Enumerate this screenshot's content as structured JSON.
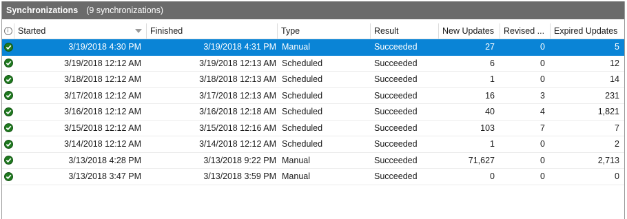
{
  "window": {
    "title": "Synchronizations",
    "count_label": "(9 synchronizations)"
  },
  "columns": {
    "info_icon": "info-icon",
    "started": "Started",
    "finished": "Finished",
    "type": "Type",
    "result": "Result",
    "new_updates": "New Updates",
    "revised": "Revised ...",
    "expired_updates": "Expired Updates"
  },
  "colors": {
    "selection": "#0a84d6",
    "success_icon": "#1f7a1f",
    "titlebar": "#6b6b6b"
  },
  "rows": [
    {
      "status_icon": "success-check-icon",
      "started": "3/19/2018 4:30 PM",
      "finished": "3/19/2018 4:31 PM",
      "type": "Manual",
      "result": "Succeeded",
      "new_updates": "27",
      "revised": "0",
      "expired": "5",
      "selected": true
    },
    {
      "status_icon": "success-check-icon",
      "started": "3/19/2018 12:12 AM",
      "finished": "3/19/2018 12:13 AM",
      "type": "Scheduled",
      "result": "Succeeded",
      "new_updates": "6",
      "revised": "0",
      "expired": "12",
      "selected": false
    },
    {
      "status_icon": "success-check-icon",
      "started": "3/18/2018 12:12 AM",
      "finished": "3/18/2018 12:13 AM",
      "type": "Scheduled",
      "result": "Succeeded",
      "new_updates": "1",
      "revised": "0",
      "expired": "14",
      "selected": false
    },
    {
      "status_icon": "success-check-icon",
      "started": "3/17/2018 12:12 AM",
      "finished": "3/17/2018 12:13 AM",
      "type": "Scheduled",
      "result": "Succeeded",
      "new_updates": "16",
      "revised": "3",
      "expired": "231",
      "selected": false
    },
    {
      "status_icon": "success-check-icon",
      "started": "3/16/2018 12:12 AM",
      "finished": "3/16/2018 12:18 AM",
      "type": "Scheduled",
      "result": "Succeeded",
      "new_updates": "40",
      "revised": "4",
      "expired": "1,821",
      "selected": false
    },
    {
      "status_icon": "success-check-icon",
      "started": "3/15/2018 12:12 AM",
      "finished": "3/15/2018 12:16 AM",
      "type": "Scheduled",
      "result": "Succeeded",
      "new_updates": "103",
      "revised": "7",
      "expired": "7",
      "selected": false
    },
    {
      "status_icon": "success-check-icon",
      "started": "3/14/2018 12:12 AM",
      "finished": "3/14/2018 12:12 AM",
      "type": "Scheduled",
      "result": "Succeeded",
      "new_updates": "1",
      "revised": "0",
      "expired": "2",
      "selected": false
    },
    {
      "status_icon": "success-check-icon",
      "started": "3/13/2018 4:28 PM",
      "finished": "3/13/2018 9:22 PM",
      "type": "Manual",
      "result": "Succeeded",
      "new_updates": "71,627",
      "revised": "0",
      "expired": "2,713",
      "selected": false
    },
    {
      "status_icon": "success-check-icon",
      "started": "3/13/2018 3:47 PM",
      "finished": "3/13/2018 3:59 PM",
      "type": "Manual",
      "result": "Succeeded",
      "new_updates": "0",
      "revised": "0",
      "expired": "0",
      "selected": false
    }
  ]
}
